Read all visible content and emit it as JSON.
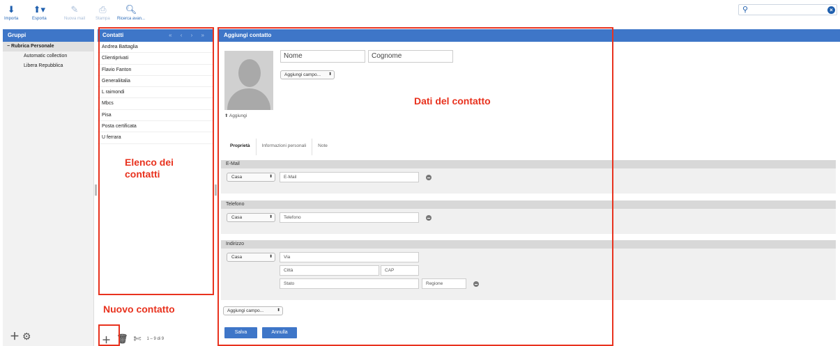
{
  "toolbar": {
    "import_label": "Importa",
    "export_label": "Esporta",
    "new_mail_label": "Nuova mail",
    "print_label": "Stampa",
    "advanced_search_label": "Ricerca avan..."
  },
  "search": {
    "placeholder": ""
  },
  "groups": {
    "header": "Gruppi",
    "root": "Rubrica Personale",
    "items": [
      "Automatic collection",
      "Libera Repubblica"
    ]
  },
  "contacts": {
    "header": "Contatti",
    "pager_arrows": "« ‹ › »",
    "items": [
      "Andrea Battaglia",
      "Clientiprivati",
      "Flavio Fanton",
      "Generaliitalia",
      "L raimondi",
      "Mbcs",
      "Pisa",
      "Posta certificata",
      "U ferrara"
    ],
    "count": "1 – 9 di 9"
  },
  "detail": {
    "header": "Aggiungi contatto",
    "first_name_placeholder": "Nome",
    "last_name_placeholder": "Cognome",
    "add_field_label": "Aggiungi campo...",
    "add_photo_label": "Aggiungi",
    "tabs": [
      "Proprietà",
      "Informazioni personali",
      "Note"
    ],
    "email": {
      "title": "E-Mail",
      "type": "Casa",
      "placeholder": "E-Mail"
    },
    "phone": {
      "title": "Telefono",
      "type": "Casa",
      "placeholder": "Telefono"
    },
    "address": {
      "title": "Indirizzo",
      "type": "Casa",
      "street": "Via",
      "city": "Città",
      "zip": "CAP",
      "country": "Stato",
      "region": "Regione"
    },
    "save_label": "Salva",
    "cancel_label": "Annulla"
  },
  "annotations": {
    "contacts_list": "Elenco dei contatti",
    "contact_data": "Dati del contatto",
    "new_contact": "Nuovo contatto"
  },
  "colors": {
    "accent": "#3e76c8",
    "annotation": "#e8321e"
  }
}
